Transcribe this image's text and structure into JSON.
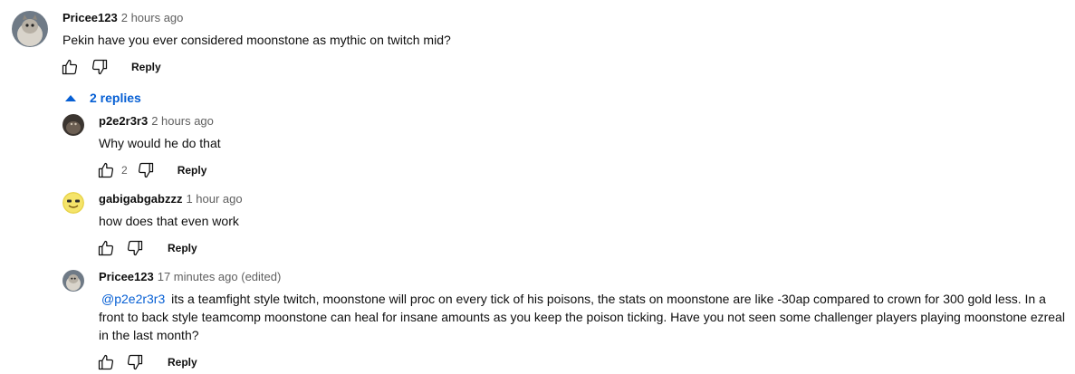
{
  "comments": [
    {
      "author": "Pricee123",
      "time": "2 hours ago",
      "text": "Pekin have you ever considered moonstone as mythic on twitch mid?",
      "reply_label": "Reply"
    }
  ],
  "replies_toggle": "2 replies",
  "replies": [
    {
      "author": "p2e2r3r3",
      "time": "2 hours ago",
      "text": "Why would he do that",
      "like_count": "2",
      "reply_label": "Reply"
    },
    {
      "author": "gabigabgabzzz",
      "time": "1 hour ago",
      "text": "how does that even work",
      "reply_label": "Reply"
    },
    {
      "author": "Pricee123",
      "time": "17 minutes ago (edited)",
      "mention": "@p2e2r3r3",
      "text": " its a teamfight style twitch, moonstone will proc on every tick of his poisons, the stats on moonstone are like -30ap compared to crown for 300 gold less. In a front to back style teamcomp moonstone can heal for insane amounts as you keep the poison ticking. Have you not seen some challenger players playing moonstone ezreal in the last month?",
      "reply_label": "Reply"
    }
  ],
  "icons": {
    "like": "thumbs-up-icon",
    "dislike": "thumbs-down-icon",
    "expand": "caret-up-icon"
  }
}
